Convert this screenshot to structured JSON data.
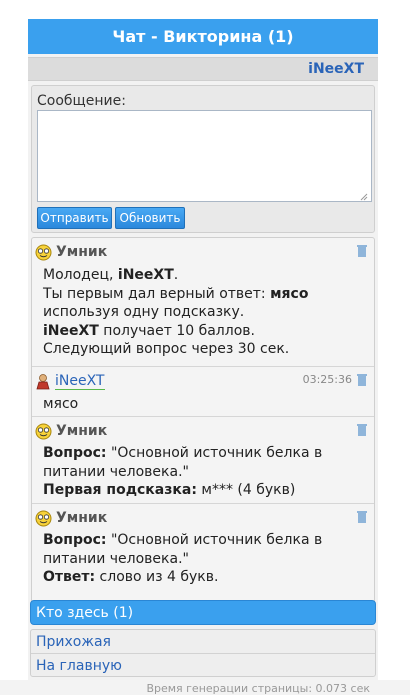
{
  "header": {
    "title": "Чат - Викторина (1)",
    "user": "iNeeXT"
  },
  "form": {
    "label": "Сообщение:",
    "message_value": "",
    "send": "Отправить",
    "refresh": "Обновить"
  },
  "messages": [
    {
      "author": "Умник",
      "lines": [
        [
          "Молодец, ",
          "iNeeXT",
          "."
        ],
        [
          "Ты первым дал верный ответ: ",
          "мясо",
          ""
        ],
        [
          "используя одну подсказку.",
          "",
          ""
        ],
        [
          "",
          "iNeeXT",
          " получает 10 баллов."
        ],
        [
          "Следующий вопрос через 30 сек.",
          "",
          ""
        ]
      ]
    },
    {
      "author": "iNeeXT",
      "time": "03:25:36",
      "text": "мясо"
    },
    {
      "author": "Умник",
      "q_label": "Вопрос:",
      "q_text": " \"Основной источник белка в",
      "q_text2": "питании человека.\"",
      "hint_label": "Первая подсказка:",
      "hint_text": " м*** (4 букв)"
    },
    {
      "author": "Умник",
      "q_label": "Вопрос:",
      "q_text": " \"Основной источник белка в",
      "q_text2": "питании человека.\"",
      "ans_label": "Ответ:",
      "ans_text": " слово из 4 букв."
    }
  ],
  "nav": {
    "who": "Кто здесь (1)",
    "hall": "Прихожая",
    "home": "На главную"
  },
  "footer": "Время генерации страницы: 0.073 сек",
  "colors": {
    "accent": "#3aa0ee",
    "link": "#2a64b8"
  },
  "icons": {
    "bot": "smiley-icon",
    "user": "user-icon",
    "delete": "trash-icon"
  }
}
